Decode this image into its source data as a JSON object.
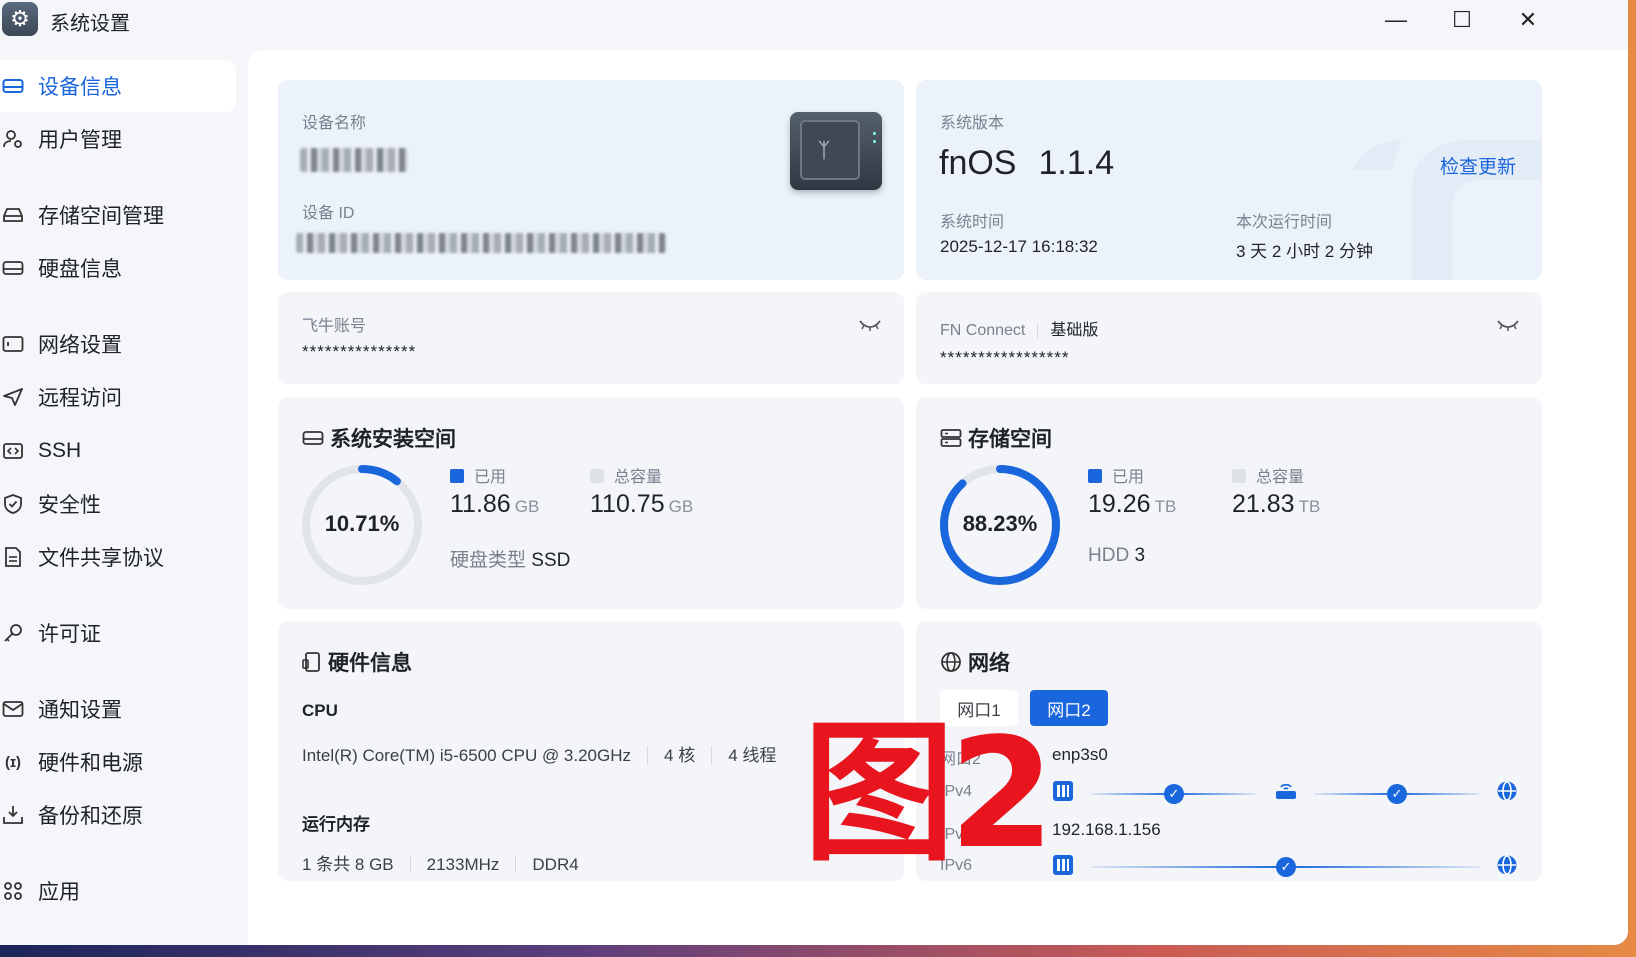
{
  "window": {
    "title": "系统设置",
    "minimize": "—",
    "maximize": "☐",
    "close": "✕"
  },
  "sidebar": {
    "items": [
      {
        "label": "设备信息",
        "icon": "device-icon"
      },
      {
        "label": "用户管理",
        "icon": "users-icon"
      },
      {
        "label": "存储空间管理",
        "icon": "storage-icon"
      },
      {
        "label": "硬盘信息",
        "icon": "disk-icon"
      },
      {
        "label": "网络设置",
        "icon": "network-icon"
      },
      {
        "label": "远程访问",
        "icon": "send-icon"
      },
      {
        "label": "SSH",
        "icon": "ssh-icon"
      },
      {
        "label": "安全性",
        "icon": "shield-icon"
      },
      {
        "label": "文件共享协议",
        "icon": "file-icon"
      },
      {
        "label": "许可证",
        "icon": "key-icon"
      },
      {
        "label": "通知设置",
        "icon": "mail-icon"
      },
      {
        "label": "硬件和电源",
        "icon": "power-icon"
      },
      {
        "label": "备份和还原",
        "icon": "backup-icon"
      },
      {
        "label": "应用",
        "icon": "apps-icon"
      }
    ],
    "active": "设备信息"
  },
  "device": {
    "name_label": "设备名称",
    "id_label": "设备 ID"
  },
  "system": {
    "version_label": "系统版本",
    "os_name": "fnOS",
    "os_version": "1.1.4",
    "check_update": "检查更新",
    "time_label": "系统时间",
    "time_value": "2025-12-17 16:18:32",
    "uptime_label": "本次运行时间",
    "uptime_value": "3 天 2 小时 2 分钟"
  },
  "account": {
    "label": "飞牛账号",
    "masked": "***************"
  },
  "fn_connect": {
    "label": "FN Connect",
    "tier": "基础版",
    "masked": "*****************"
  },
  "system_space": {
    "title": "系统安装空间",
    "percent_text": "10.71%",
    "fraction": 0.1071,
    "used_label": "已用",
    "used_value": "11.86",
    "used_unit": "GB",
    "total_label": "总容量",
    "total_value": "110.75",
    "total_unit": "GB",
    "disk_type_label": "硬盘类型",
    "disk_type_value": "SSD"
  },
  "storage": {
    "title": "存储空间",
    "percent_text": "88.23%",
    "fraction": 0.8823,
    "used_label": "已用",
    "used_value": "19.26",
    "used_unit": "TB",
    "total_label": "总容量",
    "total_value": "21.83",
    "total_unit": "TB",
    "disk_label": "HDD",
    "disk_count": "3"
  },
  "hardware": {
    "title": "硬件信息",
    "cpu_label": "CPU",
    "cpu_model": "Intel(R) Core(TM) i5-6500 CPU @ 3.20GHz",
    "cpu_cores": "4 核",
    "cpu_threads": "4 线程",
    "mem_label": "运行内存",
    "mem_modules": "1 条共 8 GB",
    "mem_speed": "2133MHz",
    "mem_type": "DDR4"
  },
  "network": {
    "title": "网络",
    "tabs": [
      "网口1",
      "网口2"
    ],
    "active_tab": "网口2",
    "port_label": "网口2",
    "port_value": "enp3s0",
    "ipv4_label": "IPv4",
    "ipv4_addr_label": "IPv4 地址",
    "ipv4_addr_value": "192.168.1.156",
    "ipv6_label": "IPv6"
  },
  "overlay": {
    "watermark": "图2"
  },
  "colors": {
    "accent": "#1a66dc",
    "ring_track": "#e1e4e9",
    "watermark": "#e8141e"
  }
}
